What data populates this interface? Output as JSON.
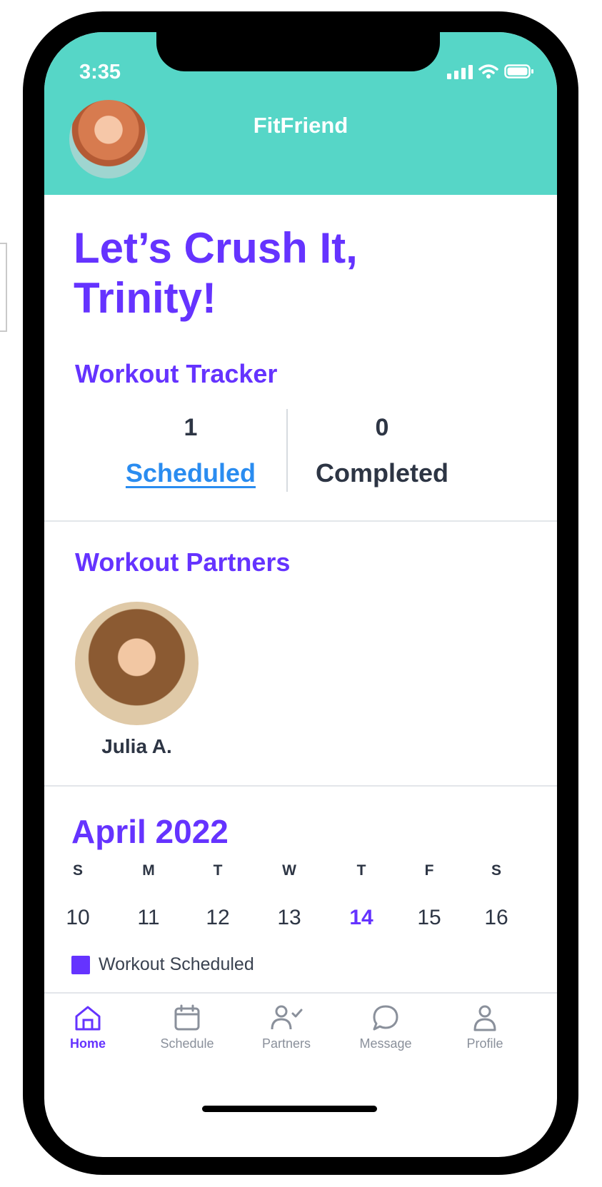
{
  "status_bar": {
    "time": "3:35"
  },
  "header": {
    "app_title": "FitFriend"
  },
  "greeting": {
    "line1": "Let’s Crush It,",
    "line2": "Trinity!"
  },
  "workout_tracker": {
    "title": "Workout Tracker",
    "scheduled_count": "1",
    "scheduled_label": "Scheduled",
    "completed_count": "0",
    "completed_label": "Completed"
  },
  "workout_partners": {
    "title": "Workout Partners",
    "partners": [
      {
        "name": "Julia A."
      }
    ]
  },
  "calendar": {
    "month_label": "April 2022",
    "weekdays": [
      "S",
      "M",
      "T",
      "W",
      "T",
      "F",
      "S"
    ],
    "days": [
      "10",
      "11",
      "12",
      "13",
      "14",
      "15",
      "16"
    ],
    "legend_label": "Workout Scheduled",
    "accent_color": "#6533ff"
  },
  "tabbar": {
    "items": [
      {
        "label": "Home",
        "icon": "home-icon"
      },
      {
        "label": "Schedule",
        "icon": "calendar-icon"
      },
      {
        "label": "Partners",
        "icon": "partners-icon"
      },
      {
        "label": "Message",
        "icon": "message-icon"
      },
      {
        "label": "Profile",
        "icon": "profile-icon"
      }
    ]
  },
  "colors": {
    "header_bg": "#56d6c7",
    "accent": "#6533ff",
    "link": "#2a8cf0"
  }
}
